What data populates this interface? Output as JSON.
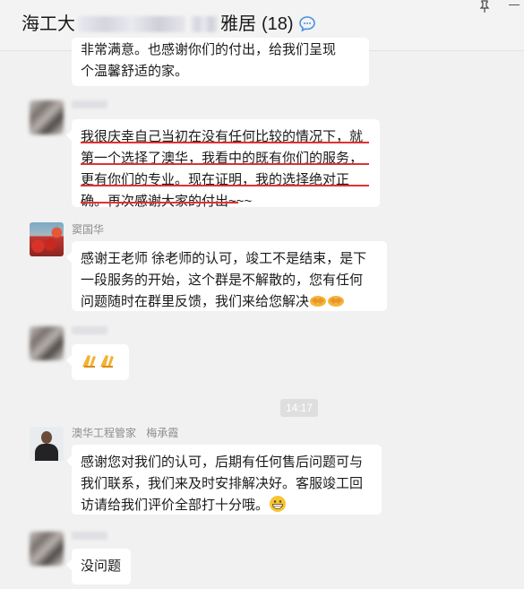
{
  "header": {
    "title_prefix": "海工大",
    "title_suffix": "雅居",
    "member_count": "(18)",
    "icons": [
      "chat-bubble-icon",
      "pin-icon",
      "minimize-icon"
    ]
  },
  "messages": [
    {
      "sender": "",
      "lines": [
        "非常满意。也感谢你们的付出，给我们呈现",
        "个温馨舒适的家。"
      ]
    },
    {
      "sender": "",
      "lines": [
        "我很庆幸自己当初在没有任何比较的情况下，就",
        "第一个选择了澳华，我看中的既有你们的服务，",
        "更有你们的专业。现在证明，我的选择绝对正",
        "确。再次感谢大家的付出~~~"
      ]
    },
    {
      "sender": "窦国华",
      "lines": [
        "感谢王老师 徐老师的认可，竣工不是结束，是下",
        "一段服务的开始，这个群是不解散的，您有任何",
        "问题随时在群里反馈，我们来给您解决"
      ],
      "emoji": [
        "handshake-emoji",
        "handshake-emoji"
      ]
    },
    {
      "sender": "",
      "emoji": [
        "clap-hands-emoji",
        "clap-hands-emoji"
      ]
    },
    {
      "timestamp": "14:17"
    },
    {
      "sender": "澳华工程管家",
      "sender_extra": "梅承霞",
      "lines": [
        "感谢您对我们的认可，后期有任何售后问题可与",
        "我们联系，我们来及时安排解决好。客服竣工回",
        "访请给我们评价全部打十分哦。"
      ],
      "emoji": [
        "grin-emoji"
      ]
    },
    {
      "sender": "",
      "lines": [
        "没问题"
      ]
    }
  ],
  "colors": {
    "underline": "#e03131",
    "bubble": "#ffffff",
    "background": "#f1f1f1"
  }
}
